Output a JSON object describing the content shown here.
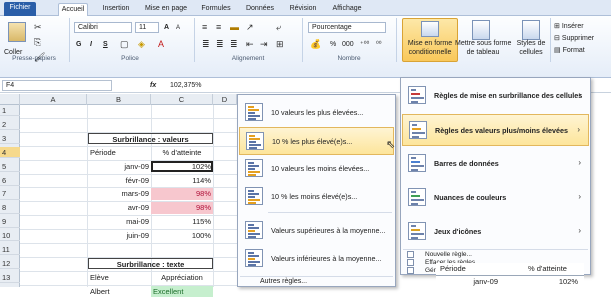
{
  "tabs": [
    "Fichier",
    "Accueil",
    "Insertion",
    "Mise en page",
    "Formules",
    "Données",
    "Révision",
    "Affichage"
  ],
  "ribbon": {
    "clipboard": {
      "paste_label": "Coller",
      "group_label": "Presse-papiers"
    },
    "font": {
      "font_name": "Calibri",
      "font_size": "11",
      "bold": "G",
      "italic": "I",
      "underline": "S",
      "grow": "A",
      "shrink": "A",
      "group_label": "Police"
    },
    "alignment": {
      "group_label": "Alignement"
    },
    "number": {
      "format": "Pourcentage",
      "percent": "%",
      "thousands": "000",
      "dec_inc": "⁺⁰⁰",
      "dec_dec": "⁰⁰",
      "group_label": "Nombre"
    },
    "styles": {
      "mfc_line1": "Mise en forme",
      "mfc_line2": "conditionnelle",
      "table_line1": "Mettre sous forme",
      "table_line2": "de tableau",
      "cell_line1": "Styles de",
      "cell_line2": "cellules"
    },
    "cells": {
      "insert": "Insérer",
      "delete": "Supprimer",
      "format": "Format"
    }
  },
  "formula_bar": {
    "name_box": "F4",
    "fx": "fx",
    "value": "102,375%"
  },
  "columns": [
    "A",
    "B",
    "C",
    "D"
  ],
  "rows": [
    "1",
    "2",
    "3",
    "4",
    "5",
    "6",
    "7",
    "8",
    "9",
    "10",
    "11",
    "12",
    "13"
  ],
  "sheet": {
    "table1": {
      "title": "Surbrillance : valeurs",
      "headers": [
        "Période",
        "% d'atteinte"
      ],
      "rows": [
        [
          "janv-09",
          "102%"
        ],
        [
          "févr-09",
          "114%"
        ],
        [
          "mars-09",
          "98%"
        ],
        [
          "avr-09",
          "98%"
        ],
        [
          "mai-09",
          "115%"
        ],
        [
          "juin-09",
          "100%"
        ]
      ],
      "highlight_color": "#f7c7ce"
    },
    "table2": {
      "title": "Surbrillance : texte",
      "headers": [
        "Elève",
        "Appréciation"
      ],
      "rows": [
        [
          "Albert",
          "Excellent"
        ]
      ],
      "highlight_color": "#c6efce"
    },
    "table3": {
      "headers": [
        "Période",
        "% d'atteinte"
      ],
      "rows": [
        [
          "janv-09",
          "102%"
        ]
      ]
    }
  },
  "menu_main": {
    "items": [
      "Règles de mise en surbrillance des cellules",
      "Règles des valeurs plus/moins élevées",
      "Barres de données",
      "Nuances de couleurs",
      "Jeux d'icônes"
    ],
    "sub": [
      "Nouvelle règle...",
      "Effacer les règles",
      "Gérer les règles..."
    ]
  },
  "menu_topbottom": {
    "items": [
      "10 valeurs les plus élevées...",
      "10 % les plus élevé(e)s...",
      "10 valeurs les moins élevées...",
      "10 % les moins élevé(e)s...",
      "Valeurs supérieures à la moyenne...",
      "Valeurs inférieures à la moyenne..."
    ],
    "more": "Autres règles..."
  }
}
